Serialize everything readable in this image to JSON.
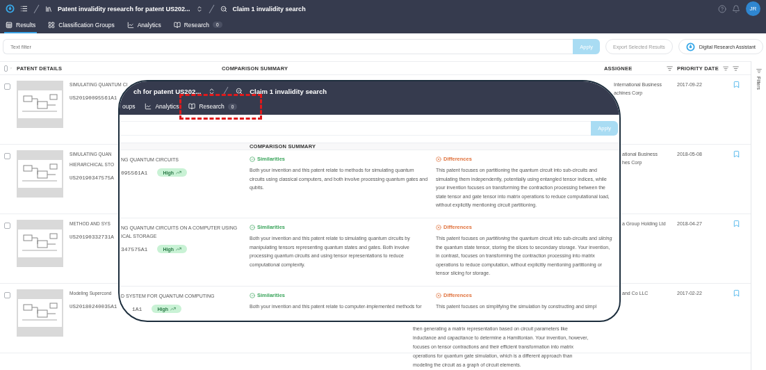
{
  "app_bar": {
    "breadcrumbs": [
      {
        "kind": "project",
        "label": "Patent invalidity research for patent US202..."
      },
      {
        "kind": "search",
        "label": "Claim 1 invalidity search"
      }
    ],
    "avatar": "JR"
  },
  "tabs": [
    {
      "kind": "table",
      "label": "Results",
      "selected": true
    },
    {
      "kind": "groups",
      "label": "Classification Groups",
      "selected": false
    },
    {
      "kind": "analytics",
      "label": "Analytics",
      "selected": false
    },
    {
      "kind": "research",
      "label": "Research",
      "count": "0",
      "selected": false
    }
  ],
  "filter": {
    "placeholder": "Text filter",
    "apply": {
      "label": "Apply",
      "disabled": true
    },
    "export": {
      "label": "Export Selected Results",
      "disabled": true
    },
    "assistant": "Digital Research Assistant"
  },
  "table": {
    "select_all": {
      "checked": false
    },
    "columns": [
      {
        "label": "PATENT DETAILS",
        "filterable": false
      },
      {
        "label": "COMPARISON SUMMARY",
        "filterable": false
      },
      {
        "label": "ASSIGNEE",
        "filterable": true
      },
      {
        "label": "PRIORITY DATE",
        "filterable": true
      }
    ],
    "rows": [
      {
        "checked": false,
        "title_lines": [
          "SIMULATING QUANTUM CI"
        ],
        "number": "US20190095561A1",
        "assignee_lines": [
          "International Business",
          "achines Corp"
        ],
        "date": "2017-09-22"
      },
      {
        "checked": false,
        "title_lines": [
          "SIMULATING QUAN",
          "HIERARCHICAL STO"
        ],
        "number": "US20190347575A",
        "assignee_lines": [
          "ational Business",
          "hes Corp"
        ],
        "date": "2018-05-08"
      },
      {
        "checked": false,
        "title_lines": [
          "METHOD AND SYS"
        ],
        "number": "US20190332731A",
        "assignee_lines": [
          "a Group Holding Ltd"
        ],
        "date": "2018-04-27"
      },
      {
        "checked": false,
        "title_lines": [
          "Modeling Supercond"
        ],
        "number": "US20180240035A1",
        "assignee_lines": [
          "and Co LLC"
        ],
        "date": "2017-02-22",
        "summary_lines": [
          "then generating a matrix representation based on circuit parameters like",
          "inductance and capacitance to determine a Hamiltonian. Your invention, however,",
          "focuses on tensor contractions and their efficient transformation into matrix",
          "operations for quantum gate simulation, which is a different approach than",
          "modeling the circuit as a graph of circuit elements."
        ]
      }
    ]
  },
  "sidebar": {
    "label": "Filters"
  },
  "magnifier": {
    "breadcrumbs": [
      {
        "kind": "project",
        "label": "ch for patent US202..."
      },
      {
        "kind": "search",
        "label": "Claim 1 invalidity search"
      }
    ],
    "tabs": [
      {
        "label": "oups",
        "selected": false
      },
      {
        "kind": "analytics",
        "label": "Analytics",
        "selected": false
      },
      {
        "kind": "research",
        "label": "Research",
        "count": "0",
        "selected": false
      }
    ],
    "apply": {
      "label": "Apply",
      "disabled": true
    },
    "column": "COMPARISON SUMMARY",
    "rows": [
      {
        "title_lines": [
          "NG QUANTUM CIRCUITS"
        ],
        "number": "095561A1",
        "relevance": "High",
        "similarities_label": "Similarities",
        "similarities": "Both your invention and this patent relate to methods for simulating quantum circuits using classical computers, and both involve processing quantum gates and qubits.",
        "differences_label": "Differences",
        "differences": "This patent focuses on partitioning the quantum circuit into sub-circuits and simulating them independently, potentially using entangled tensor indices, while your invention focuses on transforming the contraction processing between the state tensor and gate tensor into matrix operations to reduce computational load, without explicitly mentioning circuit partitioning."
      },
      {
        "title_lines": [
          "NG QUANTUM CIRCUITS ON A COMPUTER USING",
          "ICAL STORAGE"
        ],
        "number": "347575A1",
        "relevance": "High",
        "similarities_label": "Similarities",
        "similarities": "Both your invention and this patent relate to simulating quantum circuits by manipulating tensors representing quantum states and gates. Both involve processing quantum circuits and using tensor representations to reduce computational complexity.",
        "differences_label": "Differences",
        "differences": "This patent focuses on *partitioning* the quantum circuit into sub-circuits and *slicing* the quantum state tensor, storing the slices to secondary storage. Your invention, in contrast, focuses on transforming the contraction processing into matrix operations to reduce computation, without explicitly mentioning partitioning or tensor slicing for storage."
      },
      {
        "title_lines": [
          "D SYSTEM FOR QUANTUM COMPUTING"
        ],
        "number": "1A1",
        "relevance": "High",
        "similarities_label": "Similarities",
        "similarities": "Both your invention and this patent relate to computer-implemented methods for",
        "differences_label": "Differences",
        "differences": "This patent focuses on simplifying the simulation by constructing and simpl"
      }
    ]
  }
}
